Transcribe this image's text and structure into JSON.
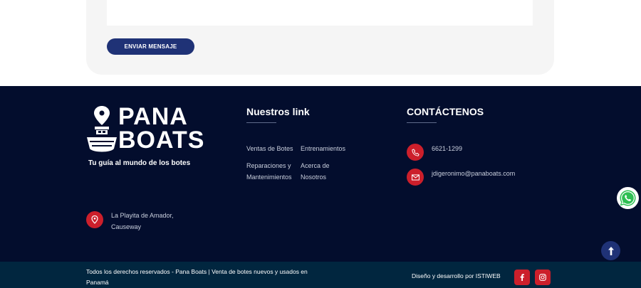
{
  "form": {
    "message_value": "",
    "send_label": "ENVIAR MENSAJE"
  },
  "brand": {
    "line1": "PANA",
    "line2": "BOATS",
    "tagline": "Tu guía al mundo de los botes"
  },
  "links": {
    "title": "Nuestros link",
    "items": [
      {
        "label": "Ventas de Botes"
      },
      {
        "label": "Entrenamientos"
      },
      {
        "label": "Reparaciones y Mantenimientos"
      },
      {
        "label": "Acerca de Nosotros"
      }
    ]
  },
  "contact": {
    "title": "CONTÁCTENOS",
    "phone": "6621-1299",
    "email": "jdigeronimo@panaboats.com"
  },
  "address": {
    "line1": "La Playita de Amador,",
    "line2": "Causeway"
  },
  "bottom": {
    "copyright": "Todos los derechos reservados - Pana Boats | Venta de botes nuevos y usados en Panamá",
    "credit": "Diseño y desarrollo por ISTIWEB"
  },
  "colors": {
    "footer_bg": "#030d2d",
    "bottom_bar_bg": "#01263f",
    "accent_red": "#cc1f2b",
    "primary_blue": "#1f3276"
  }
}
